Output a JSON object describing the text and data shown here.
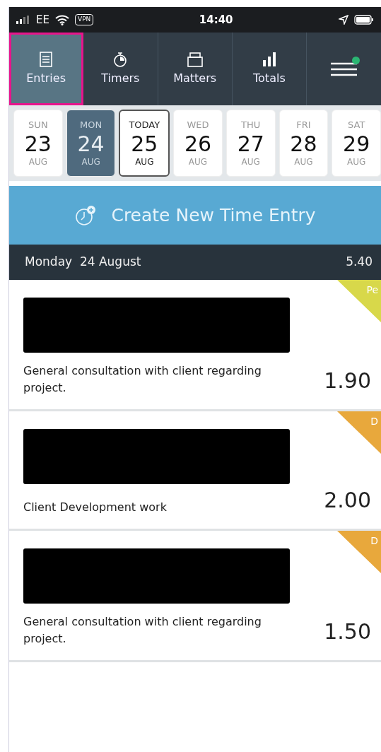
{
  "status_bar": {
    "carrier": "EE",
    "vpn": "VPN",
    "time": "14:40"
  },
  "tabs": [
    {
      "label": "Entries",
      "selected": true
    },
    {
      "label": "Timers",
      "selected": false
    },
    {
      "label": "Matters",
      "selected": false
    },
    {
      "label": "Totals",
      "selected": false
    }
  ],
  "menu": {
    "notification": true
  },
  "days": [
    {
      "weekday": "SUN",
      "date": "23",
      "month": "AUG",
      "selected": false,
      "today": false
    },
    {
      "weekday": "MON",
      "date": "24",
      "month": "AUG",
      "selected": true,
      "today": false
    },
    {
      "weekday": "TODAY",
      "date": "25",
      "month": "AUG",
      "selected": false,
      "today": true
    },
    {
      "weekday": "WED",
      "date": "26",
      "month": "AUG",
      "selected": false,
      "today": false
    },
    {
      "weekday": "THU",
      "date": "27",
      "month": "AUG",
      "selected": false,
      "today": false
    },
    {
      "weekday": "FRI",
      "date": "28",
      "month": "AUG",
      "selected": false,
      "today": false
    },
    {
      "weekday": "SAT",
      "date": "29",
      "month": "AUG",
      "selected": false,
      "today": false
    }
  ],
  "create_button": "Create New Time Entry",
  "day_header": {
    "title": "Monday  24 August",
    "total": "5.40"
  },
  "entries": [
    {
      "tag": "Pe",
      "color": "#d8d84a",
      "description": "General consultation with client regarding project.",
      "hours": "1.90"
    },
    {
      "tag": "D",
      "color": "#e8a83c",
      "description": "Client Development work",
      "hours": "2.00"
    },
    {
      "tag": "D",
      "color": "#e8a83c",
      "description": "General consultation with client regarding project.",
      "hours": "1.50"
    }
  ]
}
